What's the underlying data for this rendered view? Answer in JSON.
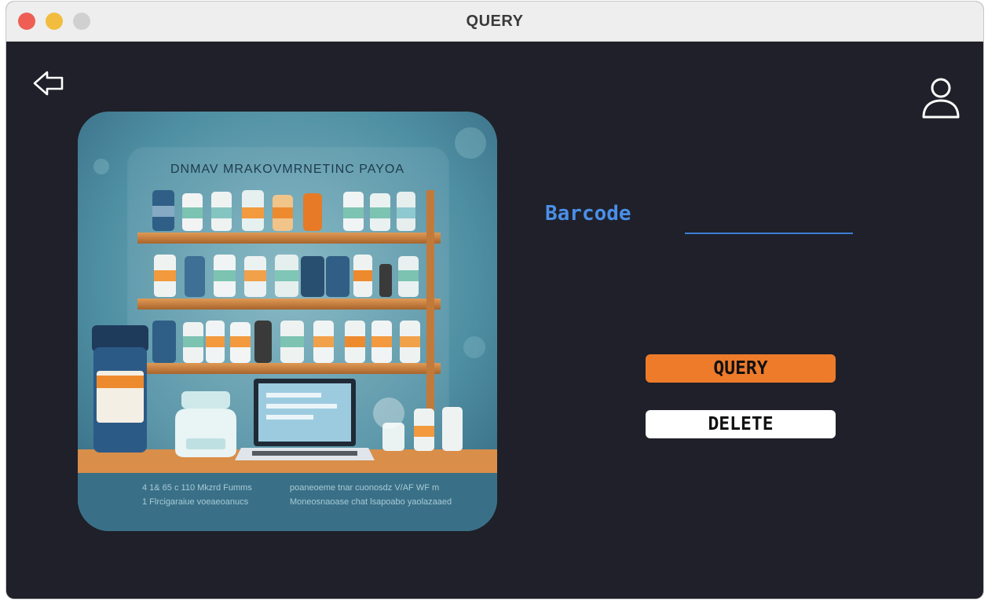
{
  "window": {
    "title": "QUERY"
  },
  "nav": {
    "back_icon": "back-arrow-icon",
    "user_icon": "user-icon"
  },
  "hero": {
    "headline": "DNMAV MRAKOVMRNETINC PAYOA",
    "caption_line1": "4 1& 65 c 110 Mkzrd Fumms",
    "caption_line2": "1 Flrcigaraiue voeaeoanucs",
    "caption_line3": "poaneoeme tnar cuonosdz V/AF WF m",
    "caption_line4": "Moneosnaoase chat lsapoabo yaolazaaed"
  },
  "form": {
    "barcode_label": "Barcode",
    "barcode_value": "",
    "barcode_placeholder": ""
  },
  "actions": {
    "query_label": "QUERY",
    "delete_label": "DELETE"
  },
  "colors": {
    "background": "#1f2029",
    "accent_blue": "#4a8fe8",
    "query_orange": "#ee7b2a",
    "delete_white": "#ffffff"
  }
}
